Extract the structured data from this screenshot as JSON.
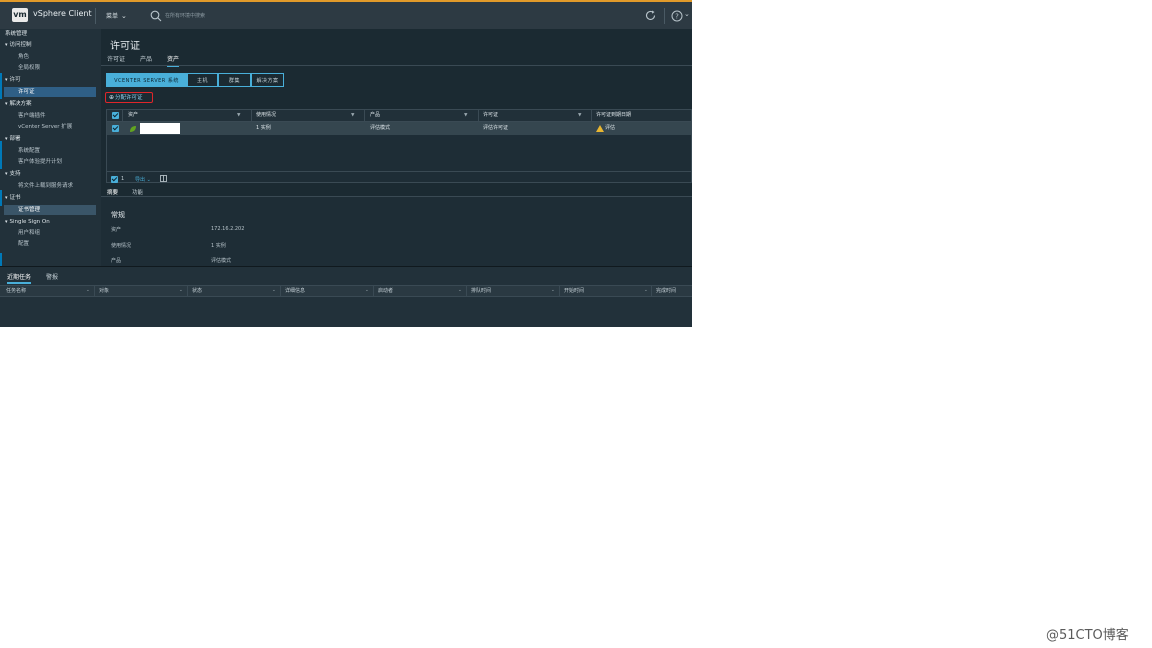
{
  "header": {
    "logo": "vm",
    "app_title": "vSphere Client",
    "menu_label": "菜单",
    "search_placeholder": "在所有环境中搜索"
  },
  "sidebar": {
    "sections": [
      {
        "label": "系统管理"
      },
      {
        "label": "访问控制",
        "items": [
          "角色",
          "全局权限"
        ]
      },
      {
        "label": "许可",
        "items": [
          "许可证"
        ]
      },
      {
        "label": "解决方案",
        "items": [
          "客户端插件",
          "vCenter Server 扩展"
        ]
      },
      {
        "label": "部署",
        "items": [
          "系统配置",
          "客户体验提升计划"
        ]
      },
      {
        "label": "支持",
        "items": [
          "将文件上载到服务请求"
        ]
      },
      {
        "label": "证书",
        "items": [
          "证书管理"
        ]
      },
      {
        "label": "Single Sign On",
        "items": [
          "用户和组",
          "配置"
        ]
      }
    ],
    "active_item": "许可证"
  },
  "content": {
    "page_title": "许可证",
    "tabs": [
      "许可证",
      "产品",
      "资产"
    ],
    "active_tab": "资产",
    "segments": [
      "VCENTER SERVER 系统",
      "主机",
      "群集",
      "解决方案"
    ],
    "active_segment": "VCENTER SERVER 系统",
    "assign_button": "分配许可证",
    "grid": {
      "columns": [
        "资产",
        "使用情况",
        "产品",
        "许可证",
        "许可证到期日期"
      ],
      "rows": [
        {
          "asset": "",
          "usage": "1 实例",
          "product": "评估模式",
          "license": "评估许可证",
          "expiry": "评估"
        }
      ],
      "footer_count": "1",
      "export_label": "导出"
    },
    "detail_tabs": [
      "摘要",
      "功能"
    ],
    "active_detail_tab": "摘要",
    "detail": {
      "section_title": "常规",
      "rows": [
        {
          "key": "资产",
          "value": "172.16.2.202"
        },
        {
          "key": "使用情况",
          "value": "1 实例"
        },
        {
          "key": "产品",
          "value": "评估模式"
        }
      ]
    }
  },
  "bottom_panel": {
    "tabs": [
      "近期任务",
      "警报"
    ],
    "active_tab": "近期任务",
    "columns": [
      "任务名称",
      "对象",
      "状态",
      "详细信息",
      "启动者",
      "排队时间",
      "开始时间",
      "完成时间"
    ]
  },
  "watermark": "@51CTO博客",
  "colors": {
    "accent": "#49afd9",
    "topbar": "#2d3a43",
    "background": "#1b2a32",
    "highlight_border": "#e0262a",
    "warning": "#e8b631"
  }
}
